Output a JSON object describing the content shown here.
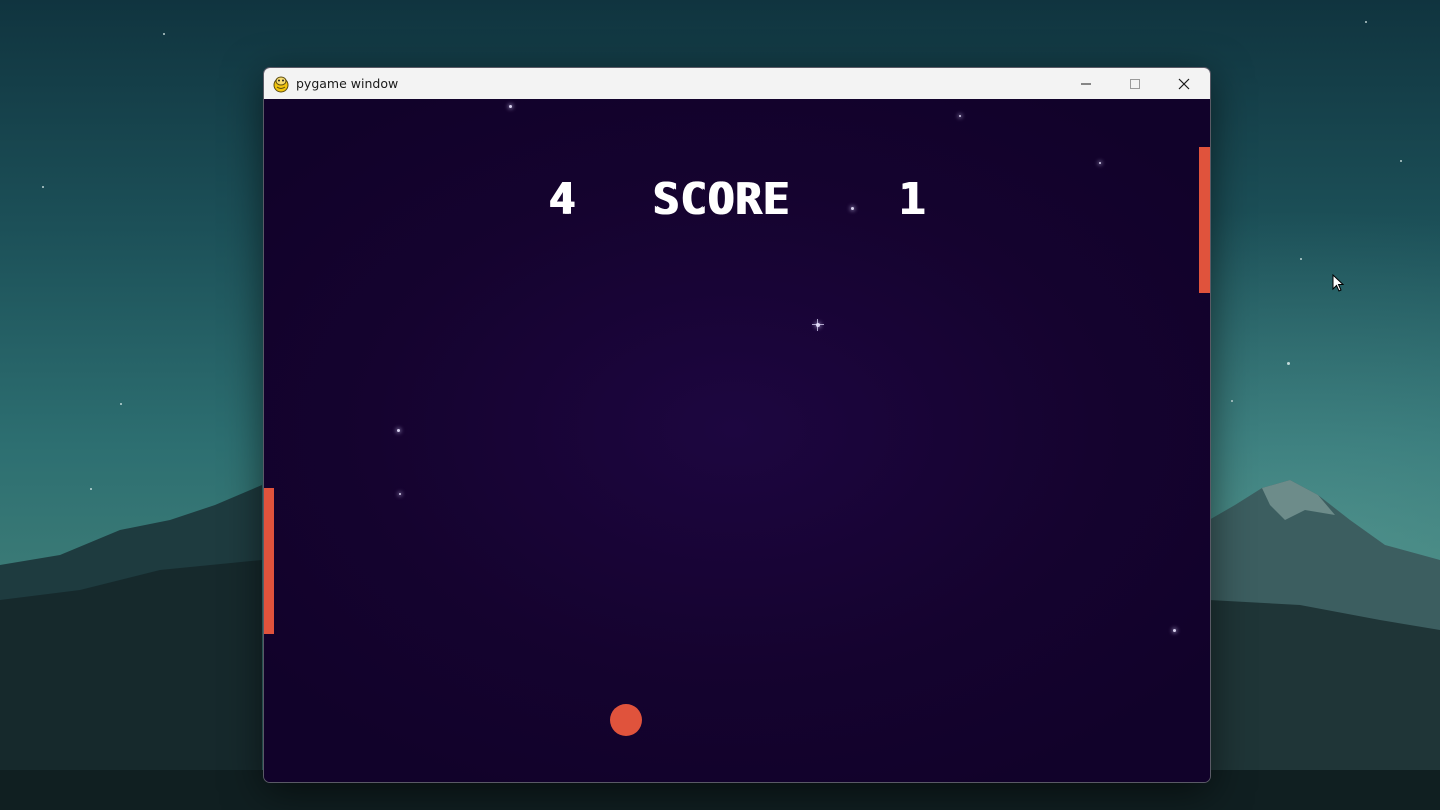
{
  "window": {
    "title": "pygame window",
    "icon": "pygame-snake-icon"
  },
  "controls": {
    "minimize_icon": "minimize-icon",
    "maximize_icon": "maximize-icon",
    "close_icon": "close-icon"
  },
  "game": {
    "score_left": "4",
    "score_label": "SCORE",
    "score_right": "1"
  },
  "colors": {
    "paddle": "#e0533c",
    "ball": "#e0533c",
    "game_background": "#14022d",
    "score_text": "#ffffff"
  }
}
